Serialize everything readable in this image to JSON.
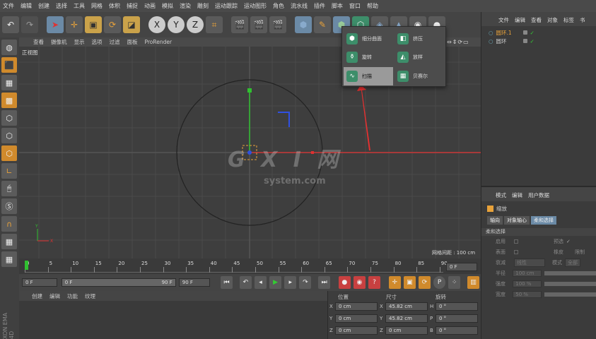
{
  "menubar": {
    "items": [
      "文件",
      "编辑",
      "创建",
      "选择",
      "工具",
      "网格",
      "体积",
      "捕捉",
      "动画",
      "模拟",
      "渲染",
      "雕刻",
      "运动跟踪",
      "运动图形",
      "角色",
      "流水线",
      "插件",
      "脚本",
      "窗口",
      "帮助"
    ]
  },
  "toolbar": {
    "undo_icon": "undo-icon",
    "axis_x": "X",
    "axis_y": "Y",
    "axis_z": "Z"
  },
  "viewport": {
    "menu": [
      "查看",
      "摄像机",
      "显示",
      "选项",
      "过滤",
      "面板",
      "ProRender"
    ],
    "view_label": "正视图",
    "grid_spacing": "网格间距 : 100 cm",
    "header_icons": "⇔⇕⟳▭"
  },
  "flyout": {
    "items": [
      {
        "label": "细分曲面",
        "icon": "subdivision-surface-icon"
      },
      {
        "label": "挤压",
        "icon": "extrude-icon"
      },
      {
        "label": "旋转",
        "icon": "lathe-icon"
      },
      {
        "label": "放样",
        "icon": "loft-icon"
      },
      {
        "label": "扫描",
        "icon": "sweep-icon",
        "selected": true
      },
      {
        "label": "贝赛尔",
        "icon": "bezier-icon"
      }
    ]
  },
  "watermark": {
    "logo": "G X I 网",
    "text": "system.com"
  },
  "timeline": {
    "ticks": [
      "0",
      "5",
      "10",
      "15",
      "20",
      "25",
      "30",
      "35",
      "40",
      "45",
      "50",
      "55",
      "60",
      "65",
      "70",
      "75",
      "80",
      "85",
      "90"
    ],
    "current_frame": "0 F"
  },
  "transport": {
    "start_frame": "0 F",
    "slider_start": "0 F",
    "slider_end": "90 F",
    "end_frame": "90 F"
  },
  "bottom_left": {
    "menu": [
      "创建",
      "编辑",
      "功能",
      "纹理"
    ],
    "brand": "XON EMA 4D"
  },
  "coords": {
    "headers": [
      "位置",
      "尺寸",
      "旋转"
    ],
    "rows": [
      {
        "axis": "X",
        "pos": "0 cm",
        "size_axis": "X",
        "size": "45.82 cm",
        "rot_axis": "H",
        "rot": "0 °"
      },
      {
        "axis": "Y",
        "pos": "0 cm",
        "size_axis": "Y",
        "size": "45.82 cm",
        "rot_axis": "P",
        "rot": "0 °"
      },
      {
        "axis": "Z",
        "pos": "0 cm",
        "size_axis": "Z",
        "size": "0 cm",
        "rot_axis": "B",
        "rot": "0 °"
      }
    ]
  },
  "objects_panel": {
    "menu": [
      "文件",
      "编辑",
      "查看",
      "对象",
      "标签",
      "书"
    ],
    "items": [
      {
        "name": "圆环.1",
        "selected": true
      },
      {
        "name": "圆环",
        "selected": false
      }
    ]
  },
  "attributes_panel": {
    "menu": [
      "模式",
      "编辑",
      "用户数据"
    ],
    "title": "缩放",
    "tabs": [
      "轴向",
      "对象轴心",
      "柔和选择"
    ],
    "section": "柔和选择",
    "rows": [
      {
        "label": "启用",
        "extra_label": "预选"
      },
      {
        "label": "表面",
        "extra_label": "橡皮",
        "extra2": "限制"
      },
      {
        "label": "衰减",
        "value": "线性",
        "extra_label": "模式",
        "extra_value": "全部"
      },
      {
        "label": "半径",
        "value": "100 cm"
      },
      {
        "label": "强度",
        "value": "100 %"
      },
      {
        "label": "宽度",
        "value": "50 %"
      }
    ]
  },
  "colors": {
    "accent_orange": "#d08a2c",
    "selection_blue": "#6b8aa6",
    "axis_red": "#e03030",
    "axis_green": "#30c030",
    "axis_blue": "#3050e0",
    "arrow_red": "#e83030",
    "flyout_green": "#3d8e6a"
  }
}
